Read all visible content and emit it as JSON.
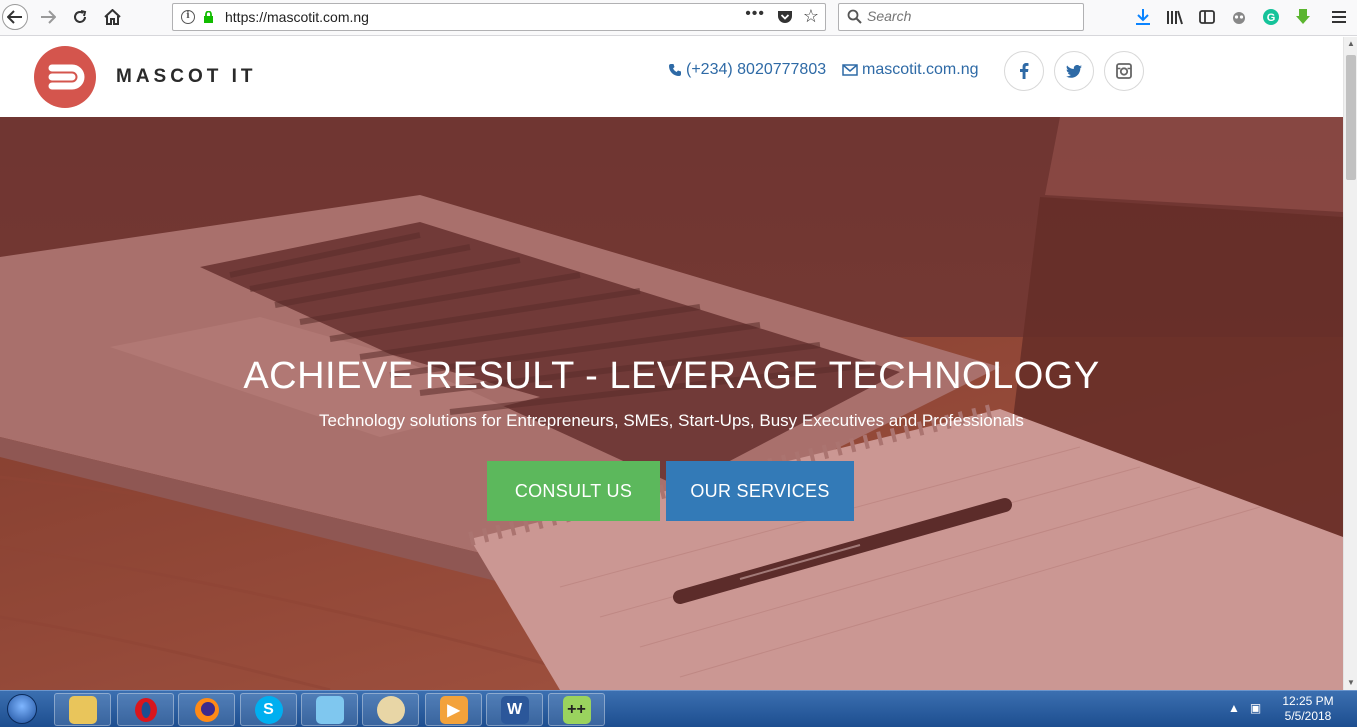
{
  "browser": {
    "url": "https://mascotit.com.ng",
    "search_placeholder": "Search"
  },
  "site": {
    "brand": "MASCOT IT",
    "phone": "(+234) 8020777803",
    "email": "mascotit.com.ng",
    "social": [
      "facebook",
      "twitter",
      "instagram"
    ]
  },
  "hero": {
    "title": "ACHIEVE RESULT - LEVERAGE TECHNOLOGY",
    "subtitle": "Technology solutions for Entrepreneurs, SMEs, Start-Ups, Busy Executives and Professionals",
    "consult_label": "CONSULT US",
    "services_label": "OUR SERVICES"
  },
  "taskbar": {
    "time": "12:25 PM",
    "date": "5/5/2018",
    "apps": [
      "file-explorer",
      "opera",
      "firefox",
      "skype",
      "notepad",
      "paint",
      "media-player",
      "word",
      "notepad-plus-plus"
    ]
  },
  "colors": {
    "brand_red": "#d4554d",
    "link_blue": "#2e6aa6",
    "consult_green": "#5cb85c",
    "services_blue": "#337ab7"
  }
}
